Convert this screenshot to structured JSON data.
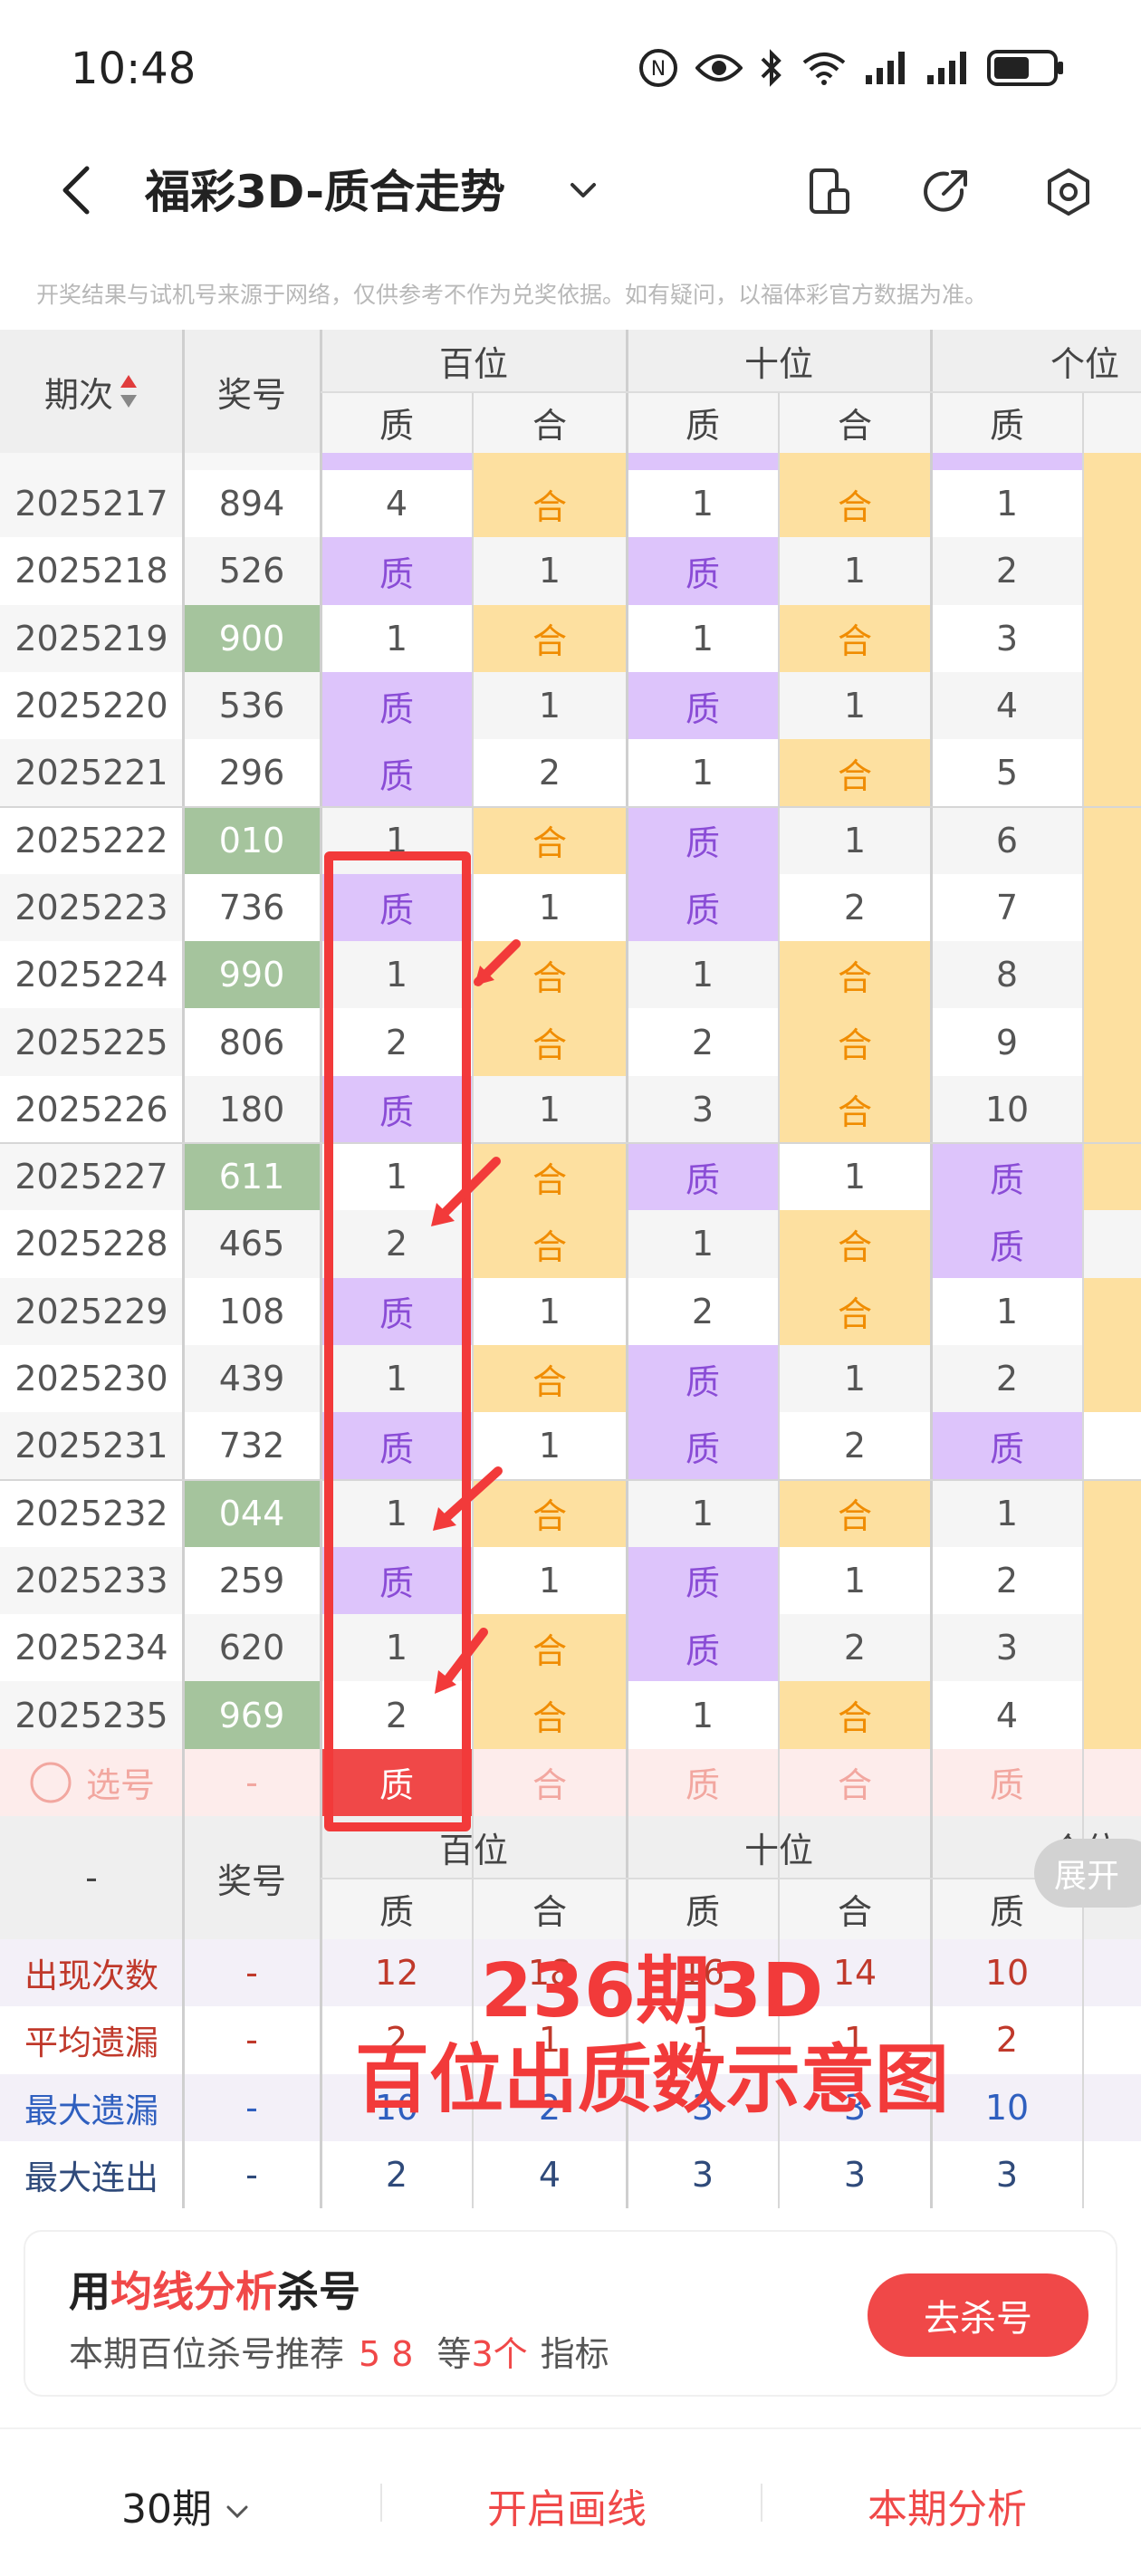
{
  "status_bar": {
    "time": "10:48"
  },
  "header": {
    "title": "福彩3D-质合走势"
  },
  "notice": "开奖结果与试机号来源于网络，仅供参考不作为兑奖依据。如有疑问，以福体彩官方数据为准。",
  "table": {
    "col_period": "期次",
    "col_number": "奖号",
    "groups": [
      "百位",
      "十位",
      "个位"
    ],
    "sub_headers": [
      "质",
      "合",
      "质",
      "合",
      "质"
    ],
    "rows": [
      {
        "period": "2025217",
        "number": "894",
        "green": false,
        "cells": [
          "4",
          "合",
          "1",
          "合",
          "1"
        ],
        "types": [
          "n",
          "he",
          "n",
          "he",
          "n"
        ]
      },
      {
        "period": "2025218",
        "number": "526",
        "green": false,
        "cells": [
          "质",
          "1",
          "质",
          "1",
          "2"
        ],
        "types": [
          "zhi",
          "n",
          "zhi",
          "n",
          "n"
        ]
      },
      {
        "period": "2025219",
        "number": "900",
        "green": true,
        "cells": [
          "1",
          "合",
          "1",
          "合",
          "3"
        ],
        "types": [
          "n",
          "he",
          "n",
          "he",
          "n"
        ]
      },
      {
        "period": "2025220",
        "number": "536",
        "green": false,
        "cells": [
          "质",
          "1",
          "质",
          "1",
          "4"
        ],
        "types": [
          "zhi",
          "n",
          "zhi",
          "n",
          "n"
        ]
      },
      {
        "period": "2025221",
        "number": "296",
        "green": false,
        "cells": [
          "质",
          "2",
          "1",
          "合",
          "5"
        ],
        "types": [
          "zhi",
          "n",
          "n",
          "he",
          "n"
        ]
      },
      {
        "period": "2025222",
        "number": "010",
        "green": true,
        "cells": [
          "1",
          "合",
          "质",
          "1",
          "6"
        ],
        "types": [
          "n",
          "he",
          "zhi",
          "n",
          "n"
        ]
      },
      {
        "period": "2025223",
        "number": "736",
        "green": false,
        "cells": [
          "质",
          "1",
          "质",
          "2",
          "7"
        ],
        "types": [
          "zhi",
          "n",
          "zhi",
          "n",
          "n"
        ]
      },
      {
        "period": "2025224",
        "number": "990",
        "green": true,
        "cells": [
          "1",
          "合",
          "1",
          "合",
          "8"
        ],
        "types": [
          "n",
          "he",
          "n",
          "he",
          "n"
        ]
      },
      {
        "period": "2025225",
        "number": "806",
        "green": false,
        "cells": [
          "2",
          "合",
          "2",
          "合",
          "9"
        ],
        "types": [
          "n",
          "he",
          "n",
          "he",
          "n"
        ]
      },
      {
        "period": "2025226",
        "number": "180",
        "green": false,
        "cells": [
          "质",
          "1",
          "3",
          "合",
          "10"
        ],
        "types": [
          "zhi",
          "n",
          "n",
          "he",
          "n"
        ]
      },
      {
        "period": "2025227",
        "number": "611",
        "green": true,
        "cells": [
          "1",
          "合",
          "质",
          "1",
          "质"
        ],
        "types": [
          "n",
          "he",
          "zhi",
          "n",
          "zhi"
        ]
      },
      {
        "period": "2025228",
        "number": "465",
        "green": false,
        "cells": [
          "2",
          "合",
          "1",
          "合",
          "质"
        ],
        "types": [
          "n",
          "he",
          "n",
          "he",
          "zhi"
        ]
      },
      {
        "period": "2025229",
        "number": "108",
        "green": false,
        "cells": [
          "质",
          "1",
          "2",
          "合",
          "1"
        ],
        "types": [
          "zhi",
          "n",
          "n",
          "he",
          "n"
        ]
      },
      {
        "period": "2025230",
        "number": "439",
        "green": false,
        "cells": [
          "1",
          "合",
          "质",
          "1",
          "2"
        ],
        "types": [
          "n",
          "he",
          "zhi",
          "n",
          "n"
        ]
      },
      {
        "period": "2025231",
        "number": "732",
        "green": false,
        "cells": [
          "质",
          "1",
          "质",
          "2",
          "质"
        ],
        "types": [
          "zhi",
          "n",
          "zhi",
          "n",
          "zhi"
        ]
      },
      {
        "period": "2025232",
        "number": "044",
        "green": true,
        "cells": [
          "1",
          "合",
          "1",
          "合",
          "1"
        ],
        "types": [
          "n",
          "he",
          "n",
          "he",
          "n"
        ]
      },
      {
        "period": "2025233",
        "number": "259",
        "green": false,
        "cells": [
          "质",
          "1",
          "质",
          "1",
          "2"
        ],
        "types": [
          "zhi",
          "n",
          "zhi",
          "n",
          "n"
        ]
      },
      {
        "period": "2025234",
        "number": "620",
        "green": false,
        "cells": [
          "1",
          "合",
          "质",
          "2",
          "3"
        ],
        "types": [
          "n",
          "he",
          "zhi",
          "n",
          "n"
        ]
      },
      {
        "period": "2025235",
        "number": "969",
        "green": true,
        "cells": [
          "2",
          "合",
          "1",
          "合",
          "4"
        ],
        "types": [
          "n",
          "he",
          "n",
          "he",
          "n"
        ]
      }
    ],
    "select_row": {
      "label": "选号",
      "number": "-",
      "cells": [
        "质",
        "合",
        "质",
        "合",
        "质"
      ]
    },
    "footer_dash": "-",
    "stats": [
      {
        "label": "出现次数",
        "dash": "-",
        "values": [
          "12",
          "18",
          "16",
          "14",
          "10"
        ],
        "color": "#c0392b"
      },
      {
        "label": "平均遗漏",
        "dash": "-",
        "values": [
          "2",
          "1",
          "1",
          "1",
          "2"
        ],
        "color": "#c0392b"
      },
      {
        "label": "最大遗漏",
        "dash": "-",
        "values": [
          "10",
          "2",
          "3",
          "3",
          "10"
        ],
        "color": "#2f5fbf"
      },
      {
        "label": "最大连出",
        "dash": "-",
        "values": [
          "2",
          "4",
          "3",
          "3",
          "3"
        ],
        "color": "#2f4a7a"
      }
    ]
  },
  "annotation": {
    "line1": "236期3D",
    "line2": "百位出质数示意图"
  },
  "expand_button": "展开",
  "card": {
    "title_prefix": "用",
    "title_highlight": "均线分析",
    "title_suffix": "杀号",
    "desc_prefix": "本期百位杀号推荐",
    "desc_numbers": "5 8",
    "desc_mid": "等",
    "desc_count": "3个",
    "desc_suffix": "指标",
    "button": "去杀号"
  },
  "bottom_bar": {
    "period": "30期",
    "draw": "开启画线",
    "analysis": "本期分析"
  },
  "colors": {
    "zhi_bg": "#ddc4fb",
    "he_bg": "#fde0a0",
    "green": "#a5c49d",
    "red": "#f04848"
  }
}
